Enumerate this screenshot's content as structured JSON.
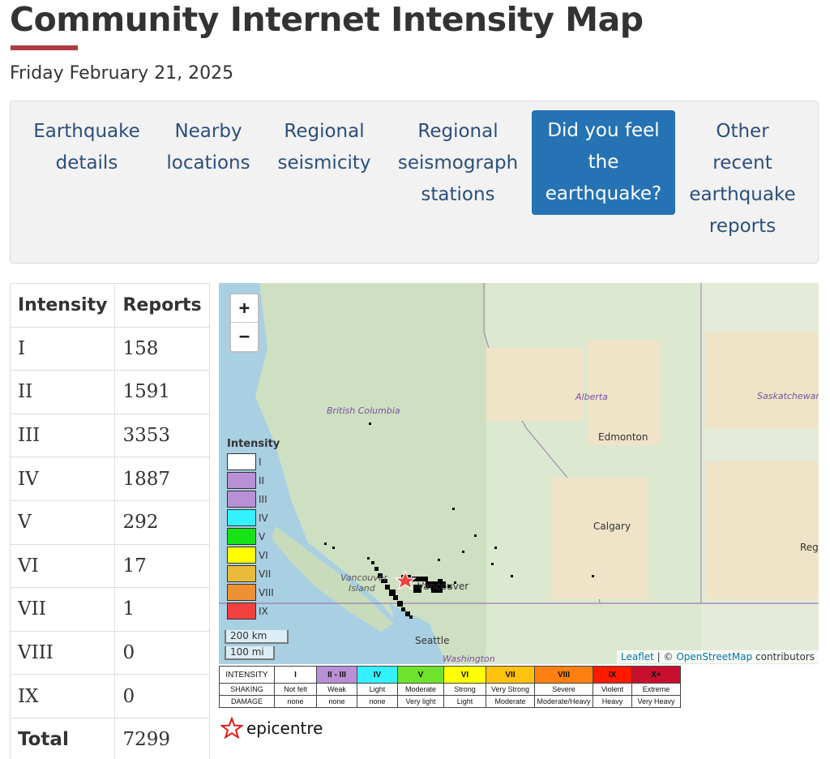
{
  "page": {
    "title": "Community Internet Intensity Map",
    "date": "Friday February 21, 2025"
  },
  "nav": {
    "items": [
      {
        "label": "Earthquake details",
        "active": false
      },
      {
        "label": "Nearby locations",
        "active": false
      },
      {
        "label": "Regional seismicity",
        "active": false
      },
      {
        "label": "Regional seismograph stations",
        "active": false
      },
      {
        "label": "Did you feel the earthquake?",
        "active": true
      },
      {
        "label": "Other recent earthquake reports",
        "active": false
      }
    ]
  },
  "counts_table": {
    "headers": [
      "Intensity",
      "Reports"
    ],
    "rows": [
      [
        "I",
        "158"
      ],
      [
        "II",
        "1591"
      ],
      [
        "III",
        "3353"
      ],
      [
        "IV",
        "1887"
      ],
      [
        "V",
        "292"
      ],
      [
        "VI",
        "17"
      ],
      [
        "VII",
        "1"
      ],
      [
        "VIII",
        "0"
      ],
      [
        "IX",
        "0"
      ]
    ],
    "total_label": "Total",
    "total_value": "7299"
  },
  "map": {
    "zoom_in": "+",
    "zoom_out": "−",
    "legend_title": "Intensity",
    "legend": [
      {
        "label": "I",
        "color": "#ffffff"
      },
      {
        "label": "II",
        "color": "#b98fd6"
      },
      {
        "label": "III",
        "color": "#b98fd6"
      },
      {
        "label": "IV",
        "color": "#33f1ff"
      },
      {
        "label": "V",
        "color": "#16e216"
      },
      {
        "label": "VI",
        "color": "#ffff00"
      },
      {
        "label": "VII",
        "color": "#eaba3a"
      },
      {
        "label": "VIII",
        "color": "#ee9135"
      },
      {
        "label": "IX",
        "color": "#f0413f"
      }
    ],
    "scale_km": "200 km",
    "scale_mi": "100 mi",
    "attribution": {
      "leaflet": "Leaflet",
      "sep": " | © ",
      "osm": "OpenStreetMap",
      "tail": " contributors"
    },
    "places": {
      "british_columbia": "British Columbia",
      "alberta": "Alberta",
      "saskatchewan": "Saskatchewan",
      "edmonton": "Edmonton",
      "calgary": "Calgary",
      "regina": "Reg",
      "vancouver_island_1": "Vancouver",
      "vancouver_island_2": "Island",
      "vancouver": "Vancouver",
      "seattle": "Seattle",
      "washington": "Washington"
    }
  },
  "intensity_scale": {
    "row_labels": [
      "INTENSITY",
      "SHAKING",
      "DAMAGE"
    ],
    "columns": [
      {
        "intensity": "I",
        "shaking": "Not felt",
        "damage": "none",
        "color": "#ffffff"
      },
      {
        "intensity": "II - III",
        "shaking": "Weak",
        "damage": "none",
        "color": "#b98fd6"
      },
      {
        "intensity": "IV",
        "shaking": "Light",
        "damage": "none",
        "color": "#33f1ff"
      },
      {
        "intensity": "V",
        "shaking": "Moderate",
        "damage": "Very light",
        "color": "#6fe22b"
      },
      {
        "intensity": "VI",
        "shaking": "Strong",
        "damage": "Light",
        "color": "#ffff00"
      },
      {
        "intensity": "VII",
        "shaking": "Very Strong",
        "damage": "Moderate",
        "color": "#ffc20e"
      },
      {
        "intensity": "VIII",
        "shaking": "Severe",
        "damage": "Moderate/Heavy",
        "color": "#ff7f11"
      },
      {
        "intensity": "IX",
        "shaking": "Violent",
        "damage": "Heavy",
        "color": "#ff1a00"
      },
      {
        "intensity": "X+",
        "shaking": "Extreme",
        "damage": "Very Heavy",
        "color": "#c8102e"
      }
    ]
  },
  "epicentre_label": "epicentre"
}
